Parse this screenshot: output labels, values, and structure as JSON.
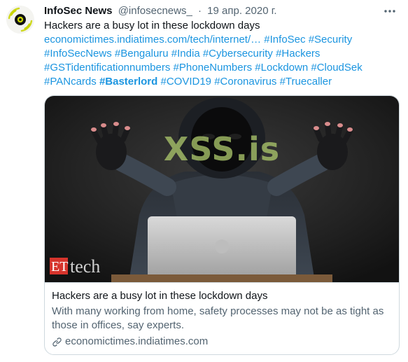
{
  "tweet": {
    "author_name": "InfoSec News",
    "author_handle": "@infosecnews_",
    "separator": "·",
    "date": "19 апр. 2020 г.",
    "more_icon": "more-horizontal-icon",
    "avatar_icon": "infosec-news-logo",
    "text_lines": [
      [
        {
          "text": "Hackers are a busy lot in these lockdown days",
          "type": "text"
        }
      ],
      [
        {
          "text": "economictimes.indiatimes.com/tech/internet/…",
          "type": "link"
        },
        {
          "text": " ",
          "type": "text"
        },
        {
          "text": "#InfoSec",
          "type": "link"
        },
        {
          "text": " ",
          "type": "text"
        },
        {
          "text": "#Security",
          "type": "link"
        }
      ],
      [
        {
          "text": "#InfoSecNews",
          "type": "link"
        },
        {
          "text": " ",
          "type": "text"
        },
        {
          "text": "#Bengaluru",
          "type": "link"
        },
        {
          "text": " ",
          "type": "text"
        },
        {
          "text": "#India",
          "type": "link"
        },
        {
          "text": " ",
          "type": "text"
        },
        {
          "text": "#Cybersecurity",
          "type": "link"
        },
        {
          "text": " ",
          "type": "text"
        },
        {
          "text": "#Hackers",
          "type": "link"
        }
      ],
      [
        {
          "text": "#GSTidentificationnumbers",
          "type": "link"
        },
        {
          "text": " ",
          "type": "text"
        },
        {
          "text": "#PhoneNumbers",
          "type": "link"
        },
        {
          "text": " ",
          "type": "text"
        },
        {
          "text": "#Lockdown",
          "type": "link"
        },
        {
          "text": " ",
          "type": "text"
        },
        {
          "text": "#CloudSek",
          "type": "link"
        }
      ],
      [
        {
          "text": "#PANcards",
          "type": "link"
        },
        {
          "text": " ",
          "type": "text"
        },
        {
          "text": "#Basterlord",
          "type": "link-bold"
        },
        {
          "text": " ",
          "type": "text"
        },
        {
          "text": "#COVID19",
          "type": "link"
        },
        {
          "text": " ",
          "type": "text"
        },
        {
          "text": "#Coronavirus",
          "type": "link"
        },
        {
          "text": " ",
          "type": "text"
        },
        {
          "text": "#Truecaller",
          "type": "link"
        }
      ]
    ]
  },
  "card": {
    "image_watermark": "XSS.is",
    "image_brand_et": "ET",
    "image_brand_tech": "tech",
    "title": "Hackers are a busy lot in these lockdown days",
    "description": "With many working from home, safety processes may not be as tight as those in offices, say experts.",
    "domain": "economictimes.indiatimes.com",
    "link_icon": "link-icon"
  },
  "colors": {
    "link": "#1b95e0",
    "secondary_text": "#536471",
    "border": "#cfd9de",
    "avatar_ring": "#c8d400"
  }
}
